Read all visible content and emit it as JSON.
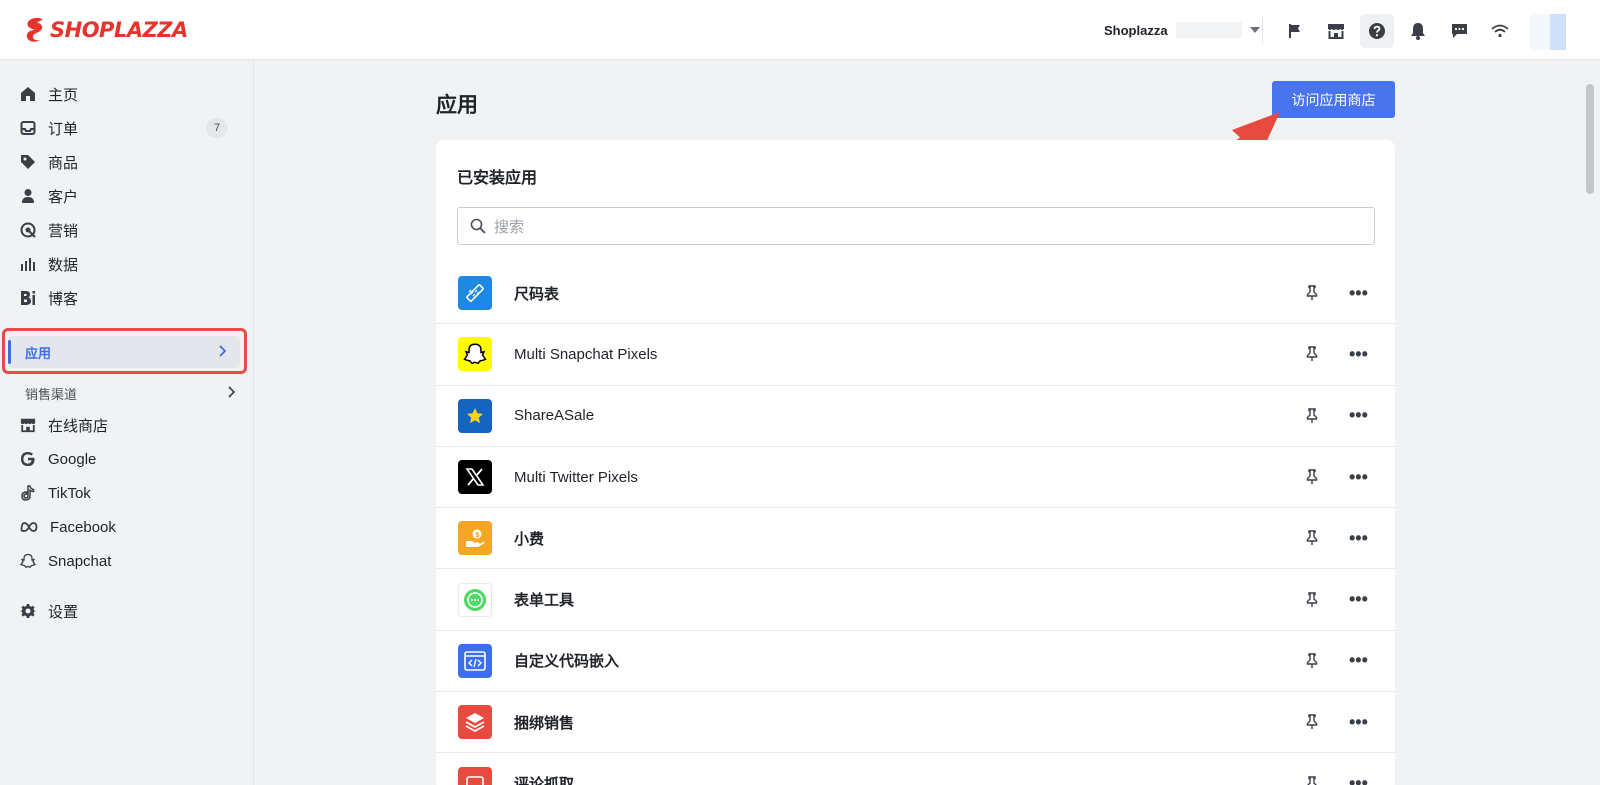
{
  "topbar": {
    "logo_text": "SHOPLAZZA",
    "store_name": "Shoplazza",
    "icons": [
      "flag-icon",
      "store-icon",
      "help-icon",
      "bell-icon",
      "chat-icon",
      "wifi-icon"
    ]
  },
  "sidebar": {
    "items": [
      {
        "label": "主页",
        "icon": "home-icon"
      },
      {
        "label": "订单",
        "icon": "inbox-icon",
        "badge": "7"
      },
      {
        "label": "商品",
        "icon": "tag-icon"
      },
      {
        "label": "客户",
        "icon": "person-icon"
      },
      {
        "label": "营销",
        "icon": "target-icon"
      },
      {
        "label": "数据",
        "icon": "bar-chart-icon"
      },
      {
        "label": "博客",
        "icon": "blog-icon"
      }
    ],
    "apps_label": "应用",
    "sales_channels_label": "销售渠道",
    "channels": [
      {
        "label": "在线商店",
        "icon": "store-icon"
      },
      {
        "label": "Google",
        "icon": "google-icon"
      },
      {
        "label": "TikTok",
        "icon": "tiktok-icon"
      },
      {
        "label": "Facebook",
        "icon": "meta-icon"
      },
      {
        "label": "Snapchat",
        "icon": "snapchat-icon"
      }
    ],
    "settings_label": "设置"
  },
  "main": {
    "title": "应用",
    "visit_store_button": "访问应用商店",
    "installed_title": "已安装应用",
    "search_placeholder": "搜索",
    "apps": [
      {
        "name": "尺码表",
        "icon": "ruler-icon",
        "color": "#1e88e5"
      },
      {
        "name": "Multi Snapchat Pixels",
        "icon": "snapchat-icon",
        "color": "#fffc00"
      },
      {
        "name": "ShareASale",
        "icon": "star-icon",
        "color": "#1565c0"
      },
      {
        "name": "Multi Twitter Pixels",
        "icon": "x-icon",
        "color": "#000000"
      },
      {
        "name": "小费",
        "icon": "tip-icon",
        "color": "#f5a623"
      },
      {
        "name": "表单工具",
        "icon": "chat-bubble-icon",
        "color": "#4cd964"
      },
      {
        "name": "自定义代码嵌入",
        "icon": "code-icon",
        "color": "#3b6ff0"
      },
      {
        "name": "捆绑销售",
        "icon": "layers-icon",
        "color": "#e84a3f"
      },
      {
        "name": "评论抓取",
        "icon": "review-icon",
        "color": "#e84a3f"
      }
    ]
  },
  "colors": {
    "brand": "#e8322b",
    "accent": "#4a74ee",
    "highlight": "#e94b47"
  }
}
